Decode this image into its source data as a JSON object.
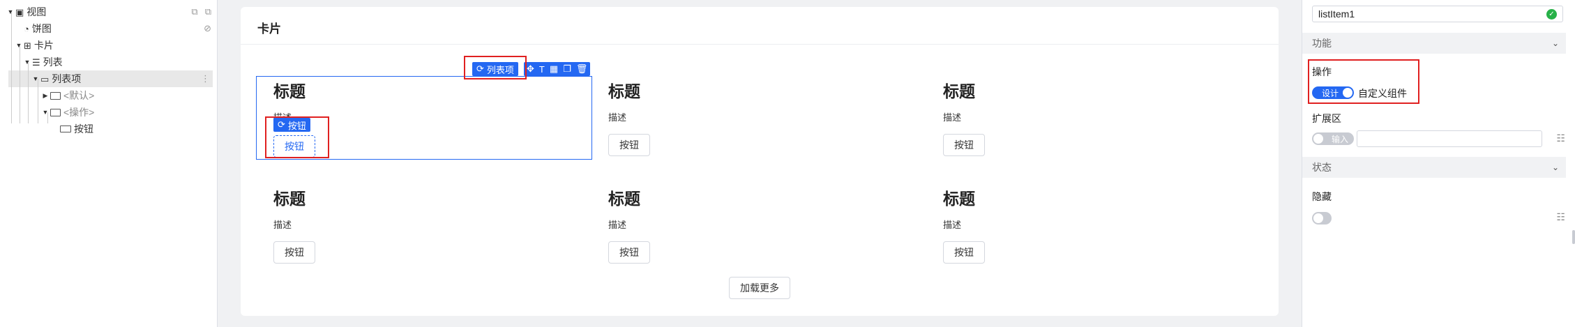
{
  "tree": {
    "root_label": "视图",
    "items": [
      {
        "label": "饼图"
      },
      {
        "label": "卡片"
      },
      {
        "label": "列表"
      },
      {
        "label": "列表项"
      },
      {
        "label": "<默认>"
      },
      {
        "label": "<操作>"
      },
      {
        "label": "按钮"
      }
    ]
  },
  "canvas": {
    "card_title": "卡片",
    "list_item_tag": "列表项",
    "button_tag": "按钮",
    "items": [
      {
        "title": "标题",
        "desc": "描述",
        "button": "按钮"
      },
      {
        "title": "标题",
        "desc": "描述",
        "button": "按钮"
      },
      {
        "title": "标题",
        "desc": "描述",
        "button": "按钮"
      },
      {
        "title": "标题",
        "desc": "描述",
        "button": "按钮"
      },
      {
        "title": "标题",
        "desc": "描述",
        "button": "按钮"
      },
      {
        "title": "标题",
        "desc": "描述",
        "button": "按钮"
      }
    ],
    "load_more": "加载更多"
  },
  "props": {
    "name_value": "listItem1",
    "section_function": "功能",
    "action_label": "操作",
    "action_toggle": "设计",
    "custom_component": "自定义组件",
    "extension_label": "扩展区",
    "extension_toggle": "输入",
    "section_state": "状态",
    "hidden_label": "隐藏"
  },
  "colors": {
    "accent": "#2468f2",
    "highlight": "#e02020",
    "valid": "#27b148"
  }
}
